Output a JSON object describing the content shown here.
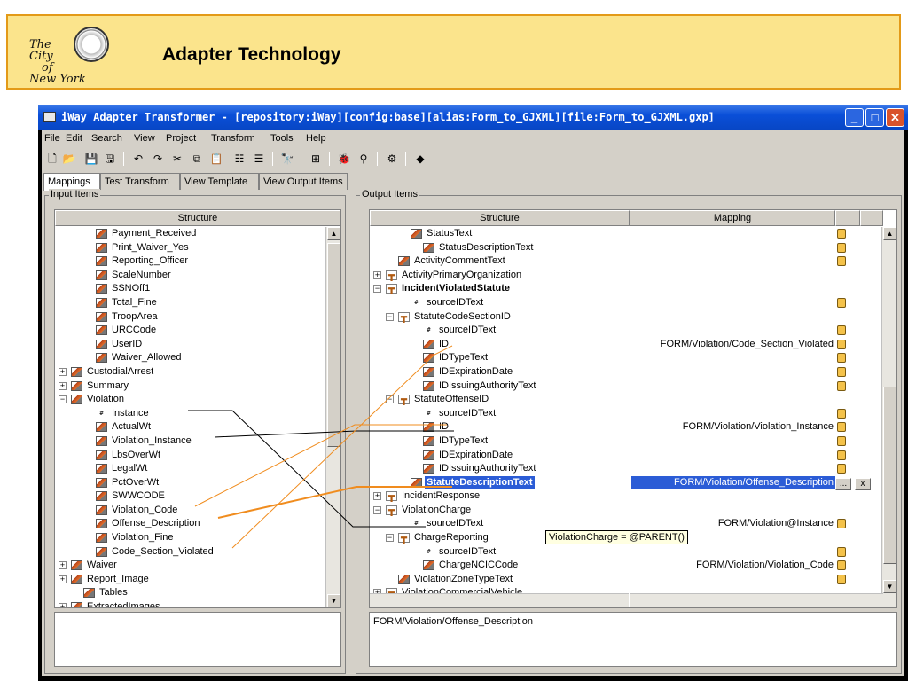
{
  "slide": {
    "title": "Adapter Technology",
    "logo_lines": [
      "The",
      "City",
      "of",
      "New York"
    ]
  },
  "window": {
    "title": "iWay Adapter Transformer - [repository:iWay][config:base][alias:Form_to_GJXML][file:Form_to_GJXML.gxp]",
    "controls": [
      "minimize",
      "maximize",
      "close"
    ]
  },
  "menu": [
    "File",
    "Edit",
    "Search",
    "View",
    "Project",
    "Transform",
    "Tools",
    "Help"
  ],
  "toolbar_icons": [
    "new-icon",
    "open-icon",
    "save-icon",
    "save-all-icon",
    "undo-icon",
    "redo-icon",
    "cut-icon",
    "copy-icon",
    "paste-icon",
    "align-icon",
    "align-right-icon",
    "binoculars-icon",
    "tree-icon",
    "bug-icon",
    "pin-icon",
    "gear-icon",
    "eraser-icon"
  ],
  "tabs": [
    "Mappings",
    "Test Transform",
    "View Template",
    "View Output Items"
  ],
  "input_panel": {
    "label": "Input Items",
    "column": "Structure",
    "rows": [
      {
        "label": "Payment_Received",
        "kind": "field",
        "indent": 3
      },
      {
        "label": "Print_Waiver_Yes",
        "kind": "field",
        "indent": 3
      },
      {
        "label": "Reporting_Officer",
        "kind": "field",
        "indent": 3
      },
      {
        "label": "ScaleNumber",
        "kind": "field",
        "indent": 3
      },
      {
        "label": "SSNOff1",
        "kind": "field",
        "indent": 3
      },
      {
        "label": "Total_Fine",
        "kind": "field",
        "indent": 3
      },
      {
        "label": "TroopArea",
        "kind": "field",
        "indent": 3
      },
      {
        "label": "URCCode",
        "kind": "field",
        "indent": 3
      },
      {
        "label": "UserID",
        "kind": "field",
        "indent": 3
      },
      {
        "label": "Waiver_Allowed",
        "kind": "field",
        "indent": 3
      },
      {
        "label": "CustodialArrest",
        "kind": "field",
        "indent": 1,
        "expander": "+"
      },
      {
        "label": "Summary",
        "kind": "field",
        "indent": 1,
        "expander": "+"
      },
      {
        "label": "Violation",
        "kind": "field",
        "indent": 1,
        "expander": "-"
      },
      {
        "label": "Instance",
        "kind": "attr",
        "indent": 3
      },
      {
        "label": "ActualWt",
        "kind": "field",
        "indent": 3
      },
      {
        "label": "Violation_Instance",
        "kind": "field",
        "indent": 3
      },
      {
        "label": "LbsOverWt",
        "kind": "field",
        "indent": 3
      },
      {
        "label": "LegalWt",
        "kind": "field",
        "indent": 3
      },
      {
        "label": "PctOverWt",
        "kind": "field",
        "indent": 3
      },
      {
        "label": "SWWCODE",
        "kind": "field",
        "indent": 3
      },
      {
        "label": "Violation_Code",
        "kind": "field",
        "indent": 3
      },
      {
        "label": "Offense_Description",
        "kind": "field",
        "indent": 3
      },
      {
        "label": "Violation_Fine",
        "kind": "field",
        "indent": 3
      },
      {
        "label": "Code_Section_Violated",
        "kind": "field",
        "indent": 3
      },
      {
        "label": "Waiver",
        "kind": "field",
        "indent": 1,
        "expander": "+"
      },
      {
        "label": "Report_Image",
        "kind": "field",
        "indent": 1,
        "expander": "+"
      },
      {
        "label": "Tables",
        "kind": "field",
        "indent": 2
      },
      {
        "label": "ExtractedImages",
        "kind": "field",
        "indent": 1,
        "expander": "+"
      }
    ]
  },
  "output_panel": {
    "label": "Output Items",
    "columns": [
      "Structure",
      "Mapping"
    ],
    "rows": [
      {
        "label": "StatusText",
        "kind": "field",
        "indent": 3,
        "mapping": "",
        "clip": true
      },
      {
        "label": "StatusDescriptionText",
        "kind": "field",
        "indent": 4,
        "mapping": "",
        "clip": true
      },
      {
        "label": "ActivityCommentText",
        "kind": "field",
        "indent": 2,
        "mapping": "",
        "clip": true
      },
      {
        "label": "ActivityPrimaryOrganization",
        "kind": "group",
        "indent": 1,
        "expander": "+",
        "mapping": "",
        "clip": false
      },
      {
        "label": "IncidentViolatedStatute",
        "kind": "group",
        "indent": 1,
        "expander": "-",
        "bold": true,
        "mapping": "",
        "clip": false
      },
      {
        "label": "sourceIDText",
        "kind": "attr",
        "indent": 3,
        "mapping": "",
        "clip": true
      },
      {
        "label": "StatuteCodeSectionID",
        "kind": "group",
        "indent": 2,
        "expander": "-",
        "mapping": "",
        "clip": false
      },
      {
        "label": "sourceIDText",
        "kind": "attr",
        "indent": 4,
        "mapping": "",
        "clip": true
      },
      {
        "label": "ID",
        "kind": "field",
        "indent": 4,
        "mapping": "FORM/Violation/Code_Section_Violated",
        "clip": true
      },
      {
        "label": "IDTypeText",
        "kind": "field",
        "indent": 4,
        "mapping": "",
        "clip": true
      },
      {
        "label": "IDExpirationDate",
        "kind": "field",
        "indent": 4,
        "mapping": "",
        "clip": true
      },
      {
        "label": "IDIssuingAuthorityText",
        "kind": "field",
        "indent": 4,
        "mapping": "",
        "clip": true
      },
      {
        "label": "StatuteOffenseID",
        "kind": "group",
        "indent": 2,
        "expander": "-",
        "mapping": "",
        "clip": false
      },
      {
        "label": "sourceIDText",
        "kind": "attr",
        "indent": 4,
        "mapping": "",
        "clip": true
      },
      {
        "label": "ID",
        "kind": "field",
        "indent": 4,
        "mapping": "FORM/Violation/Violation_Instance",
        "clip": true
      },
      {
        "label": "IDTypeText",
        "kind": "field",
        "indent": 4,
        "mapping": "",
        "clip": true
      },
      {
        "label": "IDExpirationDate",
        "kind": "field",
        "indent": 4,
        "mapping": "",
        "clip": true
      },
      {
        "label": "IDIssuingAuthorityText",
        "kind": "field",
        "indent": 4,
        "mapping": "",
        "clip": true
      },
      {
        "label": "StatuteDescriptionText",
        "kind": "field",
        "indent": 3,
        "mapping": "FORM/Violation/Offense_Description",
        "clip": true,
        "selected": true
      },
      {
        "label": "IncidentResponse",
        "kind": "group",
        "indent": 1,
        "expander": "+",
        "mapping": "",
        "clip": false
      },
      {
        "label": "ViolationCharge",
        "kind": "group",
        "indent": 1,
        "expander": "-",
        "mapping": "",
        "clip": false
      },
      {
        "label": "sourceIDText",
        "kind": "attr",
        "indent": 3,
        "mapping": "FORM/Violation@Instance",
        "clip": true
      },
      {
        "label": "ChargeReporting",
        "kind": "group",
        "indent": 2,
        "expander": "-",
        "mapping": "",
        "clip": false
      },
      {
        "label": "sourceIDText",
        "kind": "attr",
        "indent": 4,
        "mapping": "",
        "clip": true
      },
      {
        "label": "ChargeNCICCode",
        "kind": "field",
        "indent": 4,
        "mapping": "FORM/Violation/Violation_Code",
        "clip": true
      },
      {
        "label": "ViolationZoneTypeText",
        "kind": "field",
        "indent": 2,
        "mapping": "",
        "clip": true
      },
      {
        "label": "ViolationCommercialVehicle",
        "kind": "group",
        "indent": 1,
        "expander": "+",
        "mapping": "",
        "clip": false
      }
    ],
    "edit_buttons": [
      "...",
      "x"
    ],
    "tooltip": "ViolationCharge = @PARENT()",
    "description": "FORM/Violation/Offense_Description"
  },
  "colors": {
    "link_black": "#000000",
    "link_orange": "#f08c1e",
    "selection": "#2b5cd6"
  }
}
